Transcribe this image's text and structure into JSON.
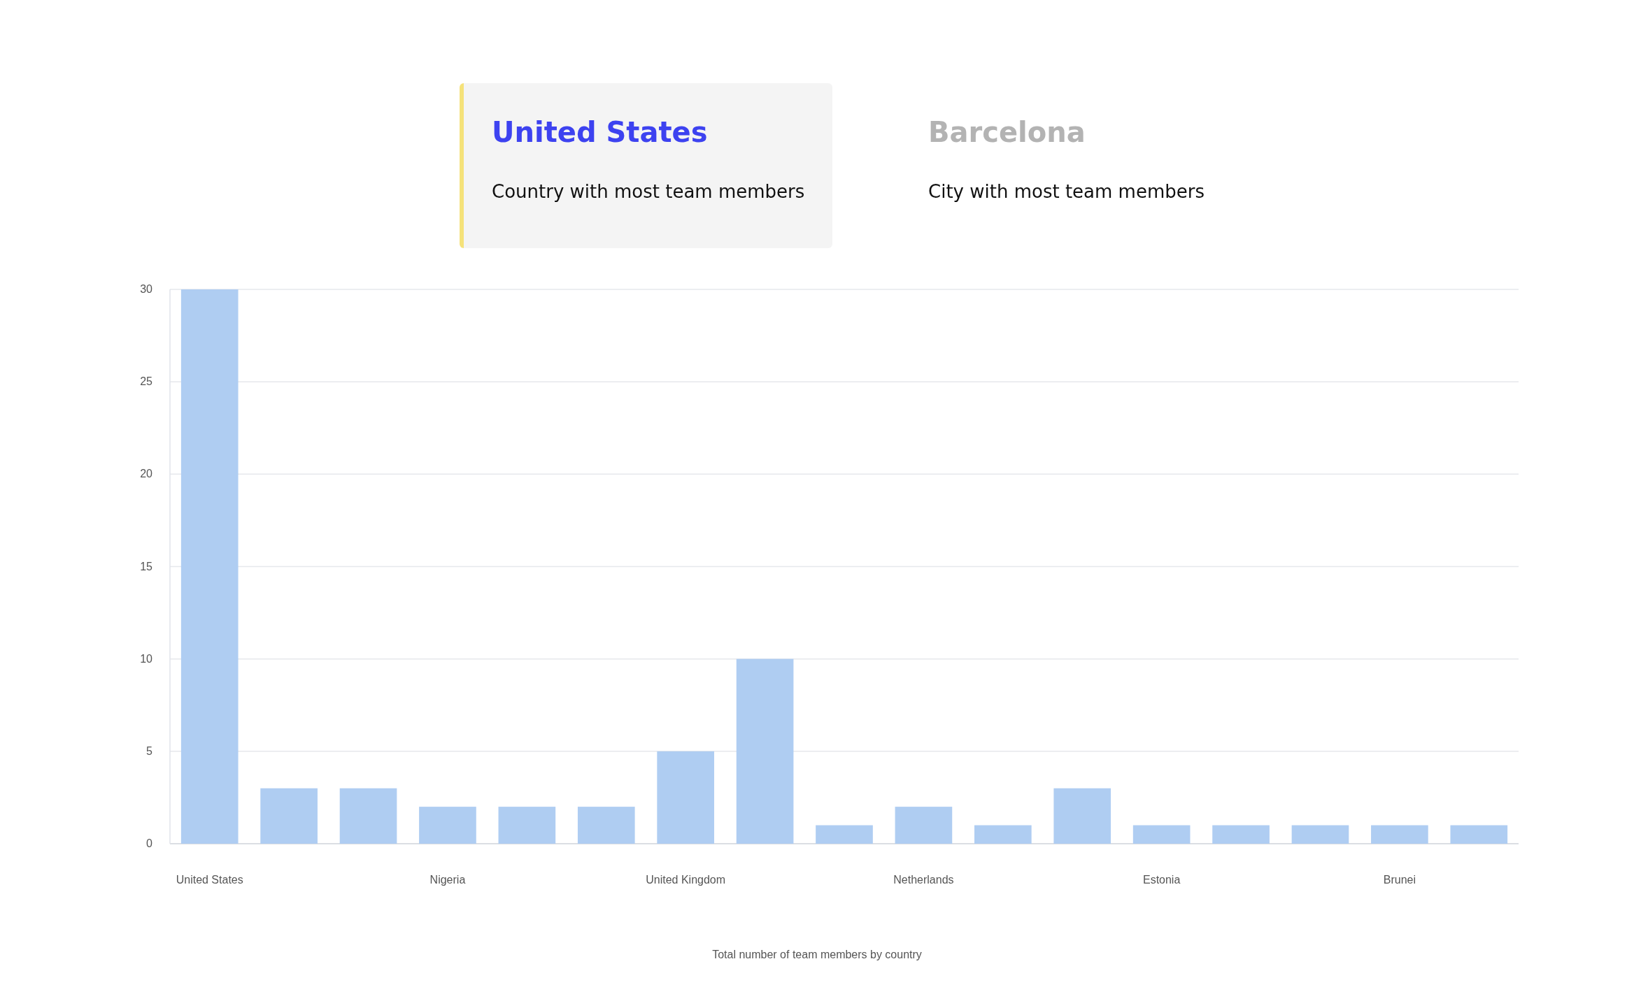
{
  "stats": [
    {
      "value": "United States",
      "label": "Country with most team members",
      "selected": true
    },
    {
      "value": "Barcelona",
      "label": "City with most team members",
      "selected": false
    }
  ],
  "chart": {
    "chart_data": {
      "type": "bar",
      "title": "Total number of team members by country",
      "categories": [
        "United States",
        null,
        null,
        "Nigeria",
        null,
        null,
        "United Kingdom",
        null,
        null,
        "Netherlands",
        null,
        null,
        "Estonia",
        null,
        null,
        "Brunei",
        null
      ],
      "grid": true,
      "series": [
        {
          "color": "#afcdf2",
          "values": [
            30,
            3,
            3,
            2,
            2,
            2,
            5,
            10,
            1,
            2,
            1,
            3,
            1,
            1,
            1,
            1,
            1
          ]
        }
      ],
      "ylim": [
        0,
        30
      ],
      "yticks": [
        0,
        5,
        10,
        15,
        20,
        25,
        30
      ]
    }
  }
}
